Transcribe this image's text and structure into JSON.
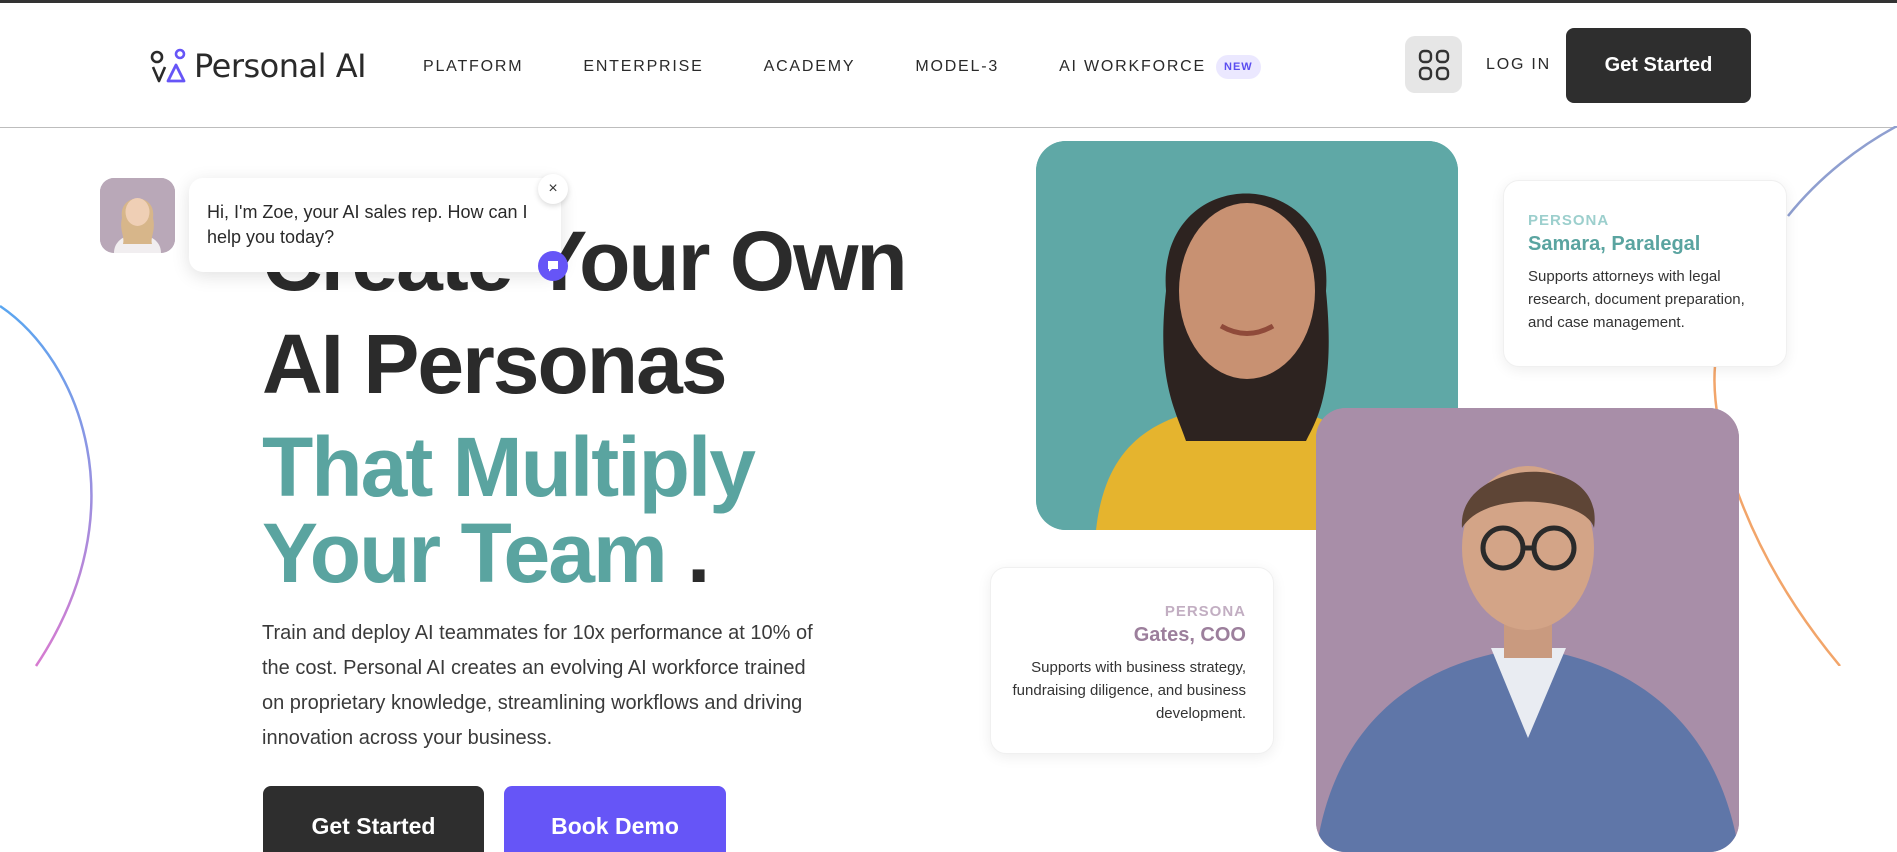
{
  "brand": {
    "name": "Personal AI"
  },
  "nav": {
    "items": [
      {
        "label": "PLATFORM"
      },
      {
        "label": "ENTERPRISE"
      },
      {
        "label": "ACADEMY"
      },
      {
        "label": "MODEL-3"
      },
      {
        "label": "AI WORKFORCE",
        "badge": "NEW"
      }
    ],
    "login": "LOG IN",
    "cta": "Get Started"
  },
  "hero": {
    "line1": "Create Your Own",
    "line2": "AI Personas",
    "line3": "That Multiply",
    "line4": "Your Team",
    "dot": ".",
    "description": "Train and deploy AI teammates for 10x performance at 10% of the cost. Personal AI creates an evolving AI workforce trained on proprietary knowledge, streamlining workflows and driving innovation across your business.",
    "primary_cta": "Get Started",
    "secondary_cta": "Book Demo"
  },
  "chat": {
    "message": "Hi, I'm Zoe, your AI sales rep. How can I help you today?",
    "close_symbol": "×"
  },
  "personas": [
    {
      "kicker": "PERSONA",
      "name": "Samara, Paralegal",
      "description": "Supports attorneys with legal research, document preparation, and case management."
    },
    {
      "kicker": "PERSONA",
      "name": "Gates, COO",
      "description": "Supports with business strategy, fundraising diligence, and business development."
    }
  ],
  "colors": {
    "accent_purple": "#6655f7",
    "teal": "#5aa4a0",
    "dark": "#2e2e2e"
  }
}
